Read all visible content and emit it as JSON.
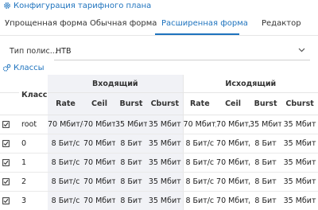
{
  "header": {
    "title": "Конфигурация тарифного плана",
    "icon": "gear-icon"
  },
  "tabs": [
    {
      "label": "Упрощенная форма",
      "active": false
    },
    {
      "label": "Обычная форма",
      "active": false
    },
    {
      "label": "Расширенная форма",
      "active": true
    },
    {
      "label": "Редактор",
      "active": false
    }
  ],
  "policy": {
    "label": "Тип полис...",
    "value": "HTB"
  },
  "classes": {
    "label": "Классы",
    "icon": "classes-gear-icon"
  },
  "table": {
    "group_headers": {
      "class": "Класс",
      "incoming": "Входящий",
      "outgoing": "Исходящий"
    },
    "columns": [
      "Rate",
      "Ceil",
      "Burst",
      "Cburst"
    ],
    "rows": [
      {
        "checked": true,
        "class": "root",
        "in": [
          "70 Мбит/с",
          "70 Мбит/с",
          "35 Мбит",
          "35 Мбит"
        ],
        "out": [
          "70 Мбит/с",
          "70 Мбит/с",
          "35 Мбит",
          "35 Мбит"
        ]
      },
      {
        "checked": true,
        "class": "0",
        "in": [
          "8 Бит/с",
          "70 Мбит/с",
          "8 Бит",
          "35 Мбит"
        ],
        "out": [
          "8 Бит/с",
          "70 Мбит/с",
          "8 Бит",
          "35 Мбит"
        ]
      },
      {
        "checked": true,
        "class": "1",
        "in": [
          "8 Бит/с",
          "70 Мбит/с",
          "8 Бит",
          "35 Мбит"
        ],
        "out": [
          "8 Бит/с",
          "70 Мбит/с",
          "8 Бит",
          "35 Мбит"
        ]
      },
      {
        "checked": true,
        "class": "2",
        "in": [
          "8 Бит/с",
          "70 Мбит/с",
          "8 Бит",
          "35 Мбит"
        ],
        "out": [
          "8 Бит/с",
          "70 Мбит/с",
          "8 Бит",
          "35 Мбит"
        ]
      },
      {
        "checked": true,
        "class": "3",
        "in": [
          "8 Бит/с",
          "70 Мбит/с",
          "8 Бит",
          "35 Мбит"
        ],
        "out": [
          "8 Бит/с",
          "70 Мбит/с",
          "8 Бит",
          "35 Мбит"
        ]
      }
    ]
  },
  "colors": {
    "accent": "#1e73be",
    "shade": "#f1f2f6",
    "divider": "#e6e6e6"
  }
}
